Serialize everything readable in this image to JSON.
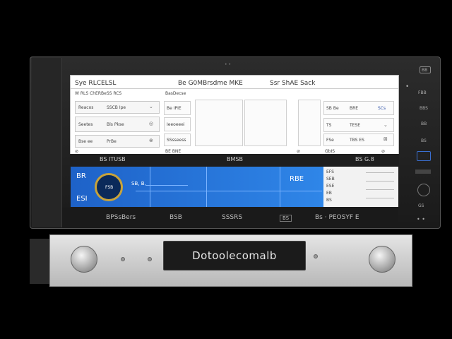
{
  "screen": {
    "header": {
      "left": "Sye RLCELSL",
      "middle": "Be G0MBrsdme MKE",
      "right": "Ssr ShAE Sack"
    },
    "left_section_title": "W RLS ChERBeSS RCS",
    "left_rows": [
      {
        "label": "Reacos",
        "value": "SSCB Ipe"
      },
      {
        "label": "Seetes",
        "value": "Bls Pkse"
      },
      {
        "label": "Bse ee",
        "value": "PrBe"
      }
    ],
    "mid_section_title": "BasDecse",
    "mid_rows": [
      "Be IPIE",
      "Ieeoeeei",
      "SSsseess"
    ],
    "mid_footer": "BE BNE",
    "right_rows": [
      {
        "a": "SB Be",
        "b": "BRE",
        "c": "SCs"
      },
      {
        "a": "TS",
        "b": "TESE",
        "c": ""
      },
      {
        "a": "FSe",
        "b": "TBS ES",
        "c": ""
      }
    ],
    "right_footer": "GbIS",
    "strip": {
      "left": "BS ITUSB",
      "middle": "BMSB",
      "right": "BS G.8"
    }
  },
  "blue_panel": {
    "top_left": "BR",
    "bottom_left": "ESI",
    "knob_value": "FSB",
    "label_a": "SB, B.",
    "label_b": "RBE",
    "right_rows": [
      "EFS",
      "SEB",
      "ESE",
      "EB",
      "BS"
    ]
  },
  "bottom_strip": {
    "a": "BPSsBers",
    "b": "BSB",
    "c": "SSSRS",
    "d": "BS",
    "e": "Bs · PEOSYF E"
  },
  "right_column": {
    "b1": "BB",
    "b2": "FBB",
    "b3": "BBS",
    "b4": "BB",
    "b5": "BS",
    "b6": "GS"
  },
  "chassis": {
    "display_text": "Dotoolecomalb"
  },
  "colors": {
    "accent_blue": "#2f86e8",
    "knob_ring": "#c8a33a",
    "display_bg": "#1b1b1b"
  }
}
